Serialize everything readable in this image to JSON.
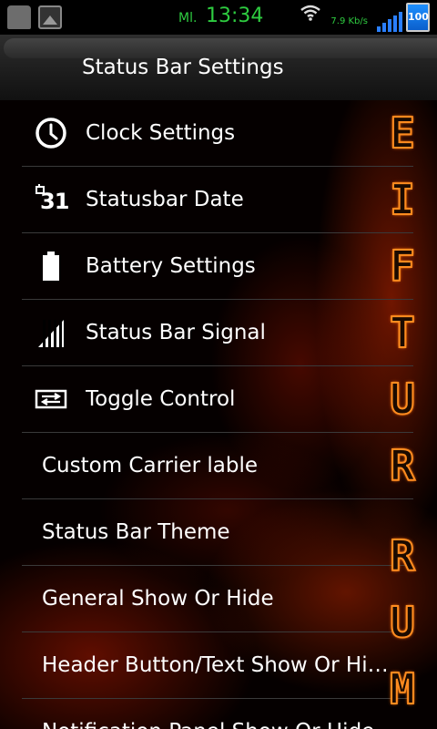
{
  "status_bar": {
    "carrier": "Ml.",
    "time": "13:34",
    "net_speed": "7.9 Kb/s",
    "battery_level": "100",
    "colors": {
      "clock": "#2ecc40",
      "battery": "#1e90ff"
    }
  },
  "header": {
    "title": "Status Bar Settings"
  },
  "menu": {
    "items": [
      {
        "label": "Clock Settings",
        "icon": "clock-icon"
      },
      {
        "label": "Statusbar Date",
        "icon": "calendar-31-icon",
        "icon_text": "31"
      },
      {
        "label": "Battery Settings",
        "icon": "battery-icon"
      },
      {
        "label": "Status Bar Signal",
        "icon": "signal-bars-icon"
      },
      {
        "label": "Toggle Control",
        "icon": "toggle-arrows-icon"
      },
      {
        "label": "Custom Carrier lable"
      },
      {
        "label": "Status Bar Theme"
      },
      {
        "label": "General Show Or Hide"
      },
      {
        "label": "Header Button/Text Show Or Hide"
      },
      {
        "label": "Notification Panel Show Or Hide"
      }
    ]
  },
  "decoration": {
    "upper_letters": [
      "E",
      "I",
      "F",
      "T",
      "U",
      "R"
    ],
    "lower_letters": [
      "R",
      "U",
      "M"
    ],
    "color": "#ff8c20"
  }
}
